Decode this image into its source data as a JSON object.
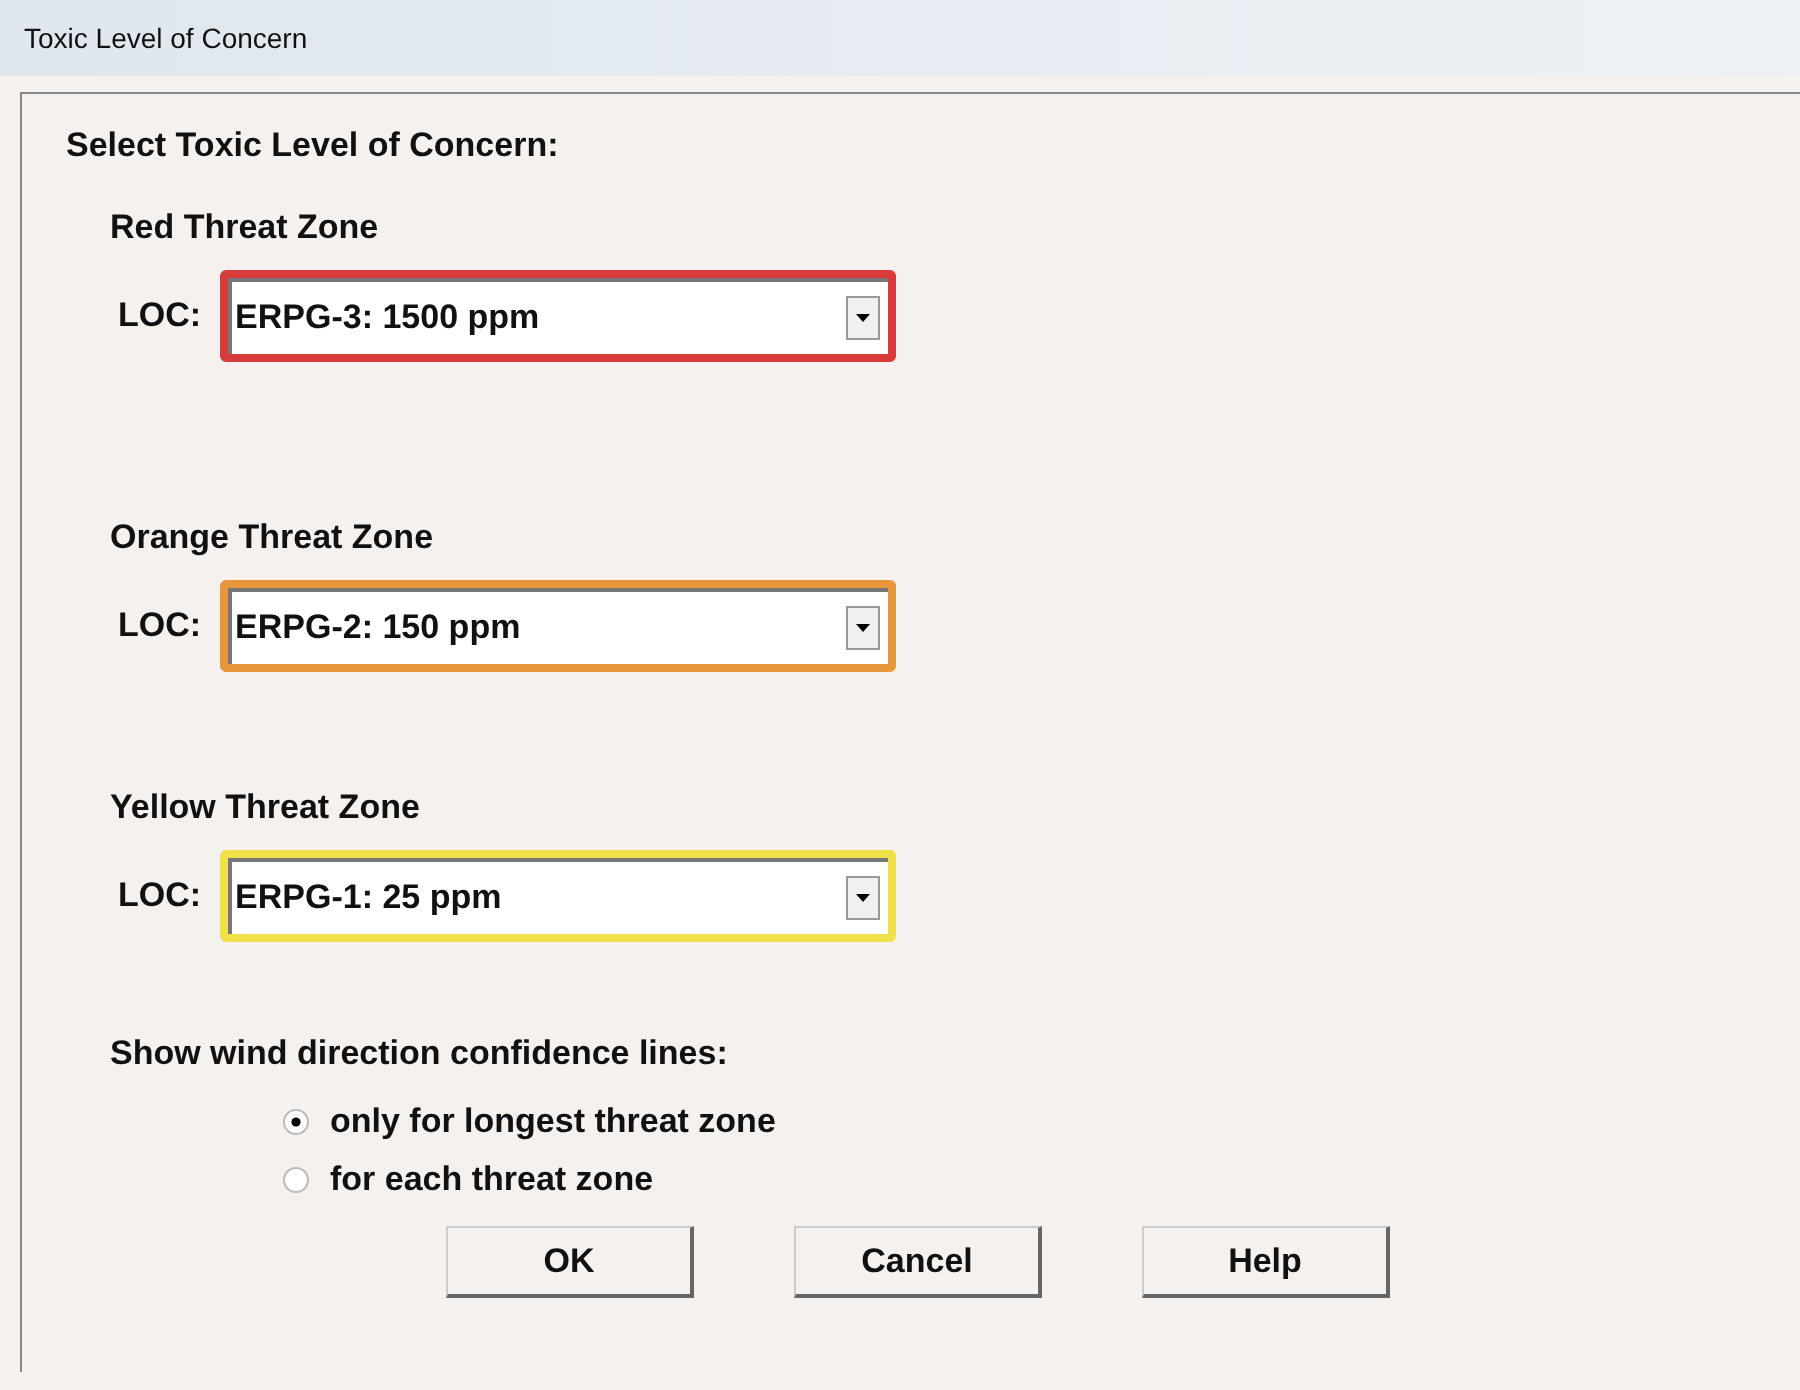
{
  "window": {
    "title": "Toxic Level of Concern"
  },
  "heading": "Select Toxic Level of Concern:",
  "zones": [
    {
      "label": "Red Threat Zone",
      "field_label": "LOC:",
      "value": "ERPG-3: 1500 ppm",
      "color": "#d93a3a"
    },
    {
      "label": "Orange Threat Zone",
      "field_label": "LOC:",
      "value": "ERPG-2: 150 ppm",
      "color": "#e8963c"
    },
    {
      "label": "Yellow Threat Zone",
      "field_label": "LOC:",
      "value": "ERPG-1: 25 ppm",
      "color": "#f0e04a"
    }
  ],
  "confidence_lines": {
    "label": "Show wind direction confidence lines:",
    "options": [
      {
        "label": "only for longest threat zone",
        "selected": true
      },
      {
        "label": "for each threat zone",
        "selected": false
      }
    ]
  },
  "buttons": [
    "OK",
    "Cancel",
    "Help"
  ]
}
